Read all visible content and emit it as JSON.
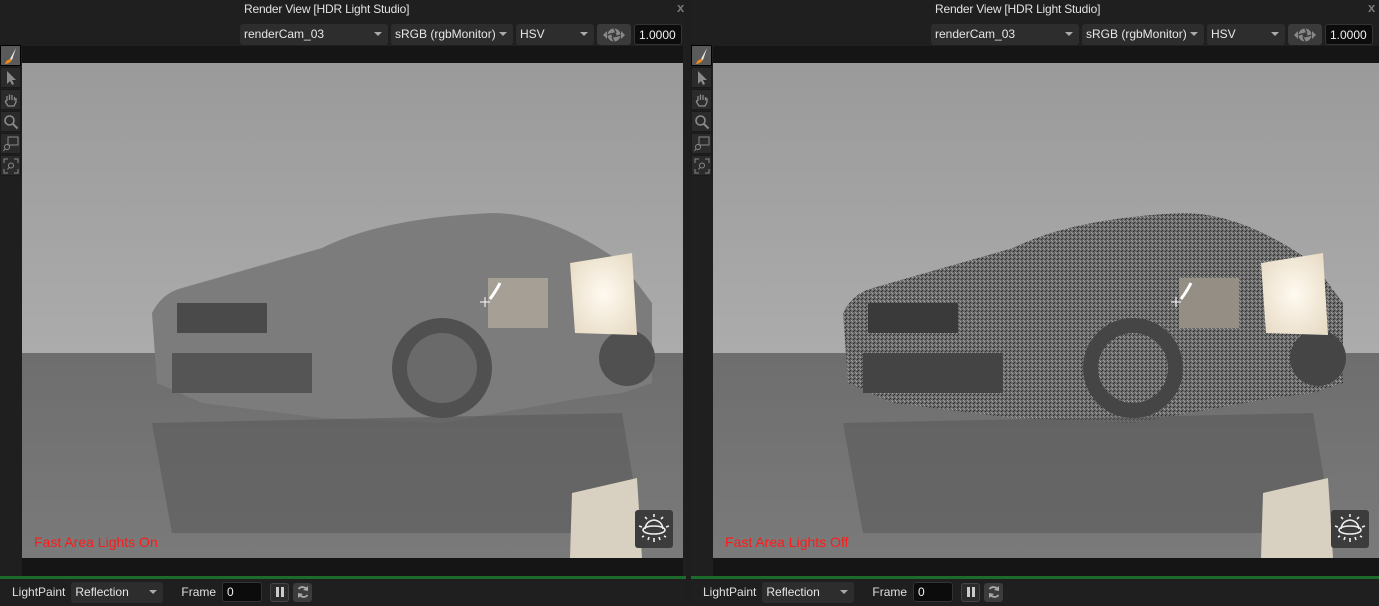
{
  "panels": [
    {
      "id": "left",
      "title": "Render View [HDR Light Studio]",
      "close_label": "x",
      "camera": "renderCam_03",
      "color_space": "sRGB (rgbMonitor)",
      "color_mode": "HSV",
      "gain": "1.0000",
      "caption": "Fast Area Lights On",
      "caption_color": "#ff1a1a",
      "bottom": {
        "mode_label": "LightPaint",
        "mode_value": "Reflection",
        "frame_label": "Frame",
        "frame_value": "0"
      }
    },
    {
      "id": "right",
      "title": "Render View [HDR Light Studio]",
      "close_label": "x",
      "camera": "renderCam_03",
      "color_space": "sRGB (rgbMonitor)",
      "color_mode": "HSV",
      "gain": "1.0000",
      "caption": "Fast Area Lights Off",
      "caption_color": "#ff1a1a",
      "bottom": {
        "mode_label": "LightPaint",
        "mode_value": "Reflection",
        "frame_label": "Frame",
        "frame_value": "0"
      }
    }
  ],
  "tools": [
    "lightpaint-brush-icon",
    "select-arrow-icon",
    "pan-hand-icon",
    "zoom-magnifier-icon",
    "zoom-region-icon",
    "zoom-fit-icon"
  ],
  "colors": {
    "accent_green": "#1d6b2a",
    "brush_orange": "#f08a1c",
    "light_panel": "#f3ece0"
  }
}
